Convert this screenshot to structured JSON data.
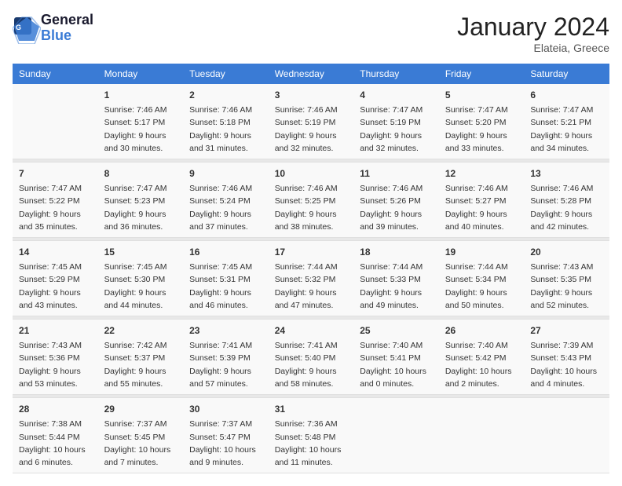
{
  "logo": {
    "text_general": "General",
    "text_blue": "Blue"
  },
  "title": "January 2024",
  "location": "Elateia, Greece",
  "days_of_week": [
    "Sunday",
    "Monday",
    "Tuesday",
    "Wednesday",
    "Thursday",
    "Friday",
    "Saturday"
  ],
  "weeks": [
    [
      {
        "day": "",
        "sunrise": "",
        "sunset": "",
        "daylight": ""
      },
      {
        "day": "1",
        "sunrise": "Sunrise: 7:46 AM",
        "sunset": "Sunset: 5:17 PM",
        "daylight": "Daylight: 9 hours and 30 minutes."
      },
      {
        "day": "2",
        "sunrise": "Sunrise: 7:46 AM",
        "sunset": "Sunset: 5:18 PM",
        "daylight": "Daylight: 9 hours and 31 minutes."
      },
      {
        "day": "3",
        "sunrise": "Sunrise: 7:46 AM",
        "sunset": "Sunset: 5:19 PM",
        "daylight": "Daylight: 9 hours and 32 minutes."
      },
      {
        "day": "4",
        "sunrise": "Sunrise: 7:47 AM",
        "sunset": "Sunset: 5:19 PM",
        "daylight": "Daylight: 9 hours and 32 minutes."
      },
      {
        "day": "5",
        "sunrise": "Sunrise: 7:47 AM",
        "sunset": "Sunset: 5:20 PM",
        "daylight": "Daylight: 9 hours and 33 minutes."
      },
      {
        "day": "6",
        "sunrise": "Sunrise: 7:47 AM",
        "sunset": "Sunset: 5:21 PM",
        "daylight": "Daylight: 9 hours and 34 minutes."
      }
    ],
    [
      {
        "day": "7",
        "sunrise": "Sunrise: 7:47 AM",
        "sunset": "Sunset: 5:22 PM",
        "daylight": "Daylight: 9 hours and 35 minutes."
      },
      {
        "day": "8",
        "sunrise": "Sunrise: 7:47 AM",
        "sunset": "Sunset: 5:23 PM",
        "daylight": "Daylight: 9 hours and 36 minutes."
      },
      {
        "day": "9",
        "sunrise": "Sunrise: 7:46 AM",
        "sunset": "Sunset: 5:24 PM",
        "daylight": "Daylight: 9 hours and 37 minutes."
      },
      {
        "day": "10",
        "sunrise": "Sunrise: 7:46 AM",
        "sunset": "Sunset: 5:25 PM",
        "daylight": "Daylight: 9 hours and 38 minutes."
      },
      {
        "day": "11",
        "sunrise": "Sunrise: 7:46 AM",
        "sunset": "Sunset: 5:26 PM",
        "daylight": "Daylight: 9 hours and 39 minutes."
      },
      {
        "day": "12",
        "sunrise": "Sunrise: 7:46 AM",
        "sunset": "Sunset: 5:27 PM",
        "daylight": "Daylight: 9 hours and 40 minutes."
      },
      {
        "day": "13",
        "sunrise": "Sunrise: 7:46 AM",
        "sunset": "Sunset: 5:28 PM",
        "daylight": "Daylight: 9 hours and 42 minutes."
      }
    ],
    [
      {
        "day": "14",
        "sunrise": "Sunrise: 7:45 AM",
        "sunset": "Sunset: 5:29 PM",
        "daylight": "Daylight: 9 hours and 43 minutes."
      },
      {
        "day": "15",
        "sunrise": "Sunrise: 7:45 AM",
        "sunset": "Sunset: 5:30 PM",
        "daylight": "Daylight: 9 hours and 44 minutes."
      },
      {
        "day": "16",
        "sunrise": "Sunrise: 7:45 AM",
        "sunset": "Sunset: 5:31 PM",
        "daylight": "Daylight: 9 hours and 46 minutes."
      },
      {
        "day": "17",
        "sunrise": "Sunrise: 7:44 AM",
        "sunset": "Sunset: 5:32 PM",
        "daylight": "Daylight: 9 hours and 47 minutes."
      },
      {
        "day": "18",
        "sunrise": "Sunrise: 7:44 AM",
        "sunset": "Sunset: 5:33 PM",
        "daylight": "Daylight: 9 hours and 49 minutes."
      },
      {
        "day": "19",
        "sunrise": "Sunrise: 7:44 AM",
        "sunset": "Sunset: 5:34 PM",
        "daylight": "Daylight: 9 hours and 50 minutes."
      },
      {
        "day": "20",
        "sunrise": "Sunrise: 7:43 AM",
        "sunset": "Sunset: 5:35 PM",
        "daylight": "Daylight: 9 hours and 52 minutes."
      }
    ],
    [
      {
        "day": "21",
        "sunrise": "Sunrise: 7:43 AM",
        "sunset": "Sunset: 5:36 PM",
        "daylight": "Daylight: 9 hours and 53 minutes."
      },
      {
        "day": "22",
        "sunrise": "Sunrise: 7:42 AM",
        "sunset": "Sunset: 5:37 PM",
        "daylight": "Daylight: 9 hours and 55 minutes."
      },
      {
        "day": "23",
        "sunrise": "Sunrise: 7:41 AM",
        "sunset": "Sunset: 5:39 PM",
        "daylight": "Daylight: 9 hours and 57 minutes."
      },
      {
        "day": "24",
        "sunrise": "Sunrise: 7:41 AM",
        "sunset": "Sunset: 5:40 PM",
        "daylight": "Daylight: 9 hours and 58 minutes."
      },
      {
        "day": "25",
        "sunrise": "Sunrise: 7:40 AM",
        "sunset": "Sunset: 5:41 PM",
        "daylight": "Daylight: 10 hours and 0 minutes."
      },
      {
        "day": "26",
        "sunrise": "Sunrise: 7:40 AM",
        "sunset": "Sunset: 5:42 PM",
        "daylight": "Daylight: 10 hours and 2 minutes."
      },
      {
        "day": "27",
        "sunrise": "Sunrise: 7:39 AM",
        "sunset": "Sunset: 5:43 PM",
        "daylight": "Daylight: 10 hours and 4 minutes."
      }
    ],
    [
      {
        "day": "28",
        "sunrise": "Sunrise: 7:38 AM",
        "sunset": "Sunset: 5:44 PM",
        "daylight": "Daylight: 10 hours and 6 minutes."
      },
      {
        "day": "29",
        "sunrise": "Sunrise: 7:37 AM",
        "sunset": "Sunset: 5:45 PM",
        "daylight": "Daylight: 10 hours and 7 minutes."
      },
      {
        "day": "30",
        "sunrise": "Sunrise: 7:37 AM",
        "sunset": "Sunset: 5:47 PM",
        "daylight": "Daylight: 10 hours and 9 minutes."
      },
      {
        "day": "31",
        "sunrise": "Sunrise: 7:36 AM",
        "sunset": "Sunset: 5:48 PM",
        "daylight": "Daylight: 10 hours and 11 minutes."
      },
      {
        "day": "",
        "sunrise": "",
        "sunset": "",
        "daylight": ""
      },
      {
        "day": "",
        "sunrise": "",
        "sunset": "",
        "daylight": ""
      },
      {
        "day": "",
        "sunrise": "",
        "sunset": "",
        "daylight": ""
      }
    ]
  ]
}
